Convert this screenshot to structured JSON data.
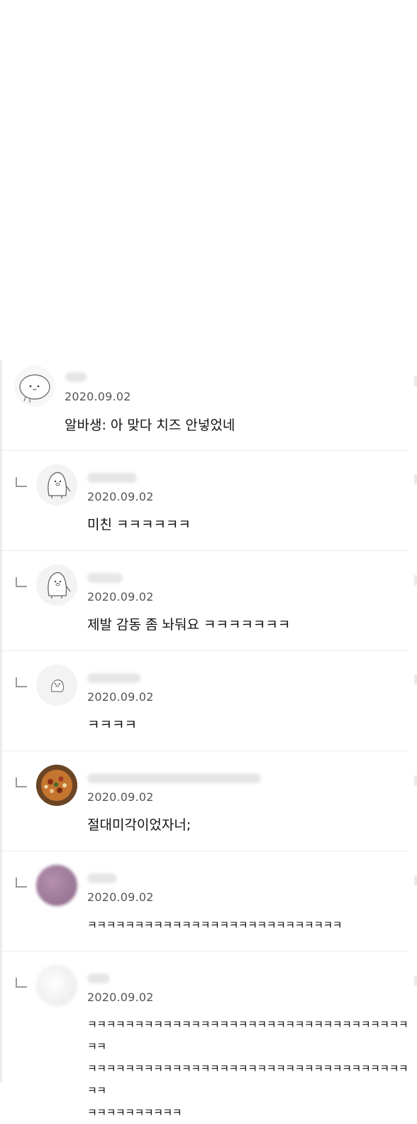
{
  "comments": [
    {
      "type": "comment",
      "avatar": "sketch-face-avatar",
      "nickname_blurred": "",
      "date": "2020.09.02",
      "text": "알바생: 아 맞다 치즈 안넣었네"
    },
    {
      "type": "reply",
      "avatar": "penguin-avatar",
      "date": "2020.09.02",
      "text": "미친 ㅋㅋㅋㅋㅋㅋ"
    },
    {
      "type": "reply",
      "avatar": "penguin-avatar",
      "date": "2020.09.02",
      "text": "제발 감동 좀 놔둬요 ㅋㅋㅋㅋㅋㅋㅋ"
    },
    {
      "type": "reply",
      "avatar": "penguin-small-avatar",
      "date": "2020.09.02",
      "text": "ㅋㅋㅋㅋ"
    },
    {
      "type": "reply",
      "avatar": "pizza-photo-avatar",
      "date": "2020.09.02",
      "text": "절대미각이었자너;"
    },
    {
      "type": "reply",
      "avatar": "blurred-photo-avatar",
      "date": "2020.09.02",
      "text": "ㅋㅋㅋㅋㅋㅋㅋㅋㅋㅋㅋㅋㅋㅋㅋㅋㅋㅋㅋㅋㅋㅋㅋㅋㅋㅋㅋ"
    },
    {
      "type": "reply",
      "avatar": "blurred-photo-avatar",
      "date": "2020.09.02",
      "text": "ㅋㅋㅋㅋㅋㅋㅋㅋㅋㅋㅋㅋㅋㅋㅋㅋㅋㅋㅋㅋㅋㅋㅋㅋㅋㅋㅋㅋㅋㅋㅋㅋㅋㅋㅋㅋ\nㅋㅋㅋㅋㅋㅋㅋㅋㅋㅋㅋㅋㅋㅋㅋㅋㅋㅋㅋㅋㅋㅋㅋㅋㅋㅋㅋㅋㅋㅋㅋㅋㅋㅋㅋㅋ\nㅋㅋㅋㅋㅋㅋㅋㅋㅋㅋ"
    }
  ],
  "colors": {
    "divider": "#ececec",
    "date": "#555555",
    "text": "#111111"
  }
}
